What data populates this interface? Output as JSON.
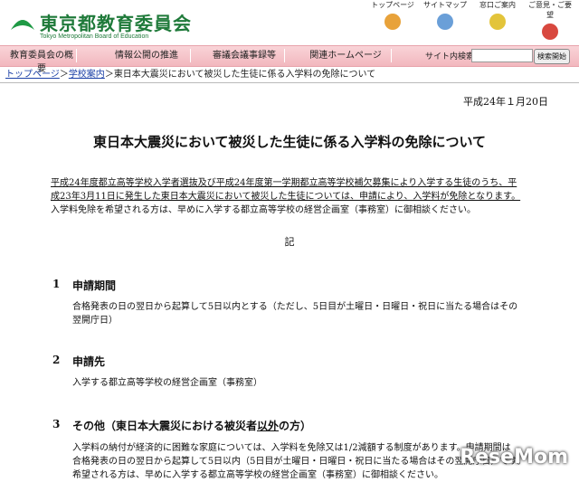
{
  "header": {
    "logo_text": "東京都教育委員会",
    "logo_sub": "Tokyo Metropolitan Board of Education",
    "util_nav": [
      {
        "label": "トップページ",
        "icon": "home-icon",
        "color": "#e8a23a"
      },
      {
        "label": "サイトマップ",
        "icon": "sitemap-icon",
        "color": "#6a9fd8"
      },
      {
        "label": "窓口ご案内",
        "icon": "info-desk-icon",
        "color": "#e3c43a"
      },
      {
        "label": "ご意見・ご要望",
        "icon": "mailbox-icon",
        "color": "#d8483f"
      }
    ]
  },
  "nav": {
    "items": [
      "教育委員会の概要",
      "情報公開の推進",
      "審議会議事録等",
      "関連ホームページ"
    ],
    "search_label": "サイト内検索",
    "search_value": "",
    "search_button": "検索開始"
  },
  "breadcrumb": {
    "top": "トップページ",
    "sep1": "＞",
    "school": "学校案内",
    "sep2": "＞",
    "current": "東日本大震災において被災した生徒に係る入学料の免除について"
  },
  "content": {
    "date": "平成24年１月20日",
    "title": "東日本大震災において被災した生徒に係る入学料の免除について",
    "intro_line1": "平成24年度都立高等学校入学者選抜及び平成24年度第一学期都立高等学校補欠募集により入学する生徒のうち、平",
    "intro_line2": "成23年3月11日に発生した東日本大震災において被災した生徒については、申請により、入学料が免除となります。",
    "intro_line3": "入学料免除を希望される方は、早めに入学する都立高等学校の経営企画室（事務室）に御相談ください。",
    "ki": "記",
    "sections": [
      {
        "num": "1",
        "title": "申請期間",
        "body1": "合格発表の日の翌日から起算して5日以内とする（ただし、5日目が土曜日・日曜日・祝日に当たる場合はその",
        "body2": "翌開庁日）"
      },
      {
        "num": "2",
        "title": "申請先",
        "body1": "入学する都立高等学校の経営企画室（事務室）",
        "body2": ""
      },
      {
        "num": "3",
        "title_a": "その他（東日本大震災における被災者",
        "title_b": "以外",
        "title_c": "の方）",
        "body1": "入学料の納付が経済的に困難な家庭については、入学料を免除又は1/2減額する制度があります。申請期間は",
        "body2": "合格発表の日の翌日から起算して5日以内（5日目が土曜日・日曜日・祝日に当たる場合はその翌開庁日）です。",
        "body3": "希望される方は、早めに入学する都立高等学校の経営企画室（事務室）に御相談ください。"
      }
    ]
  },
  "watermark": "ReseMom"
}
